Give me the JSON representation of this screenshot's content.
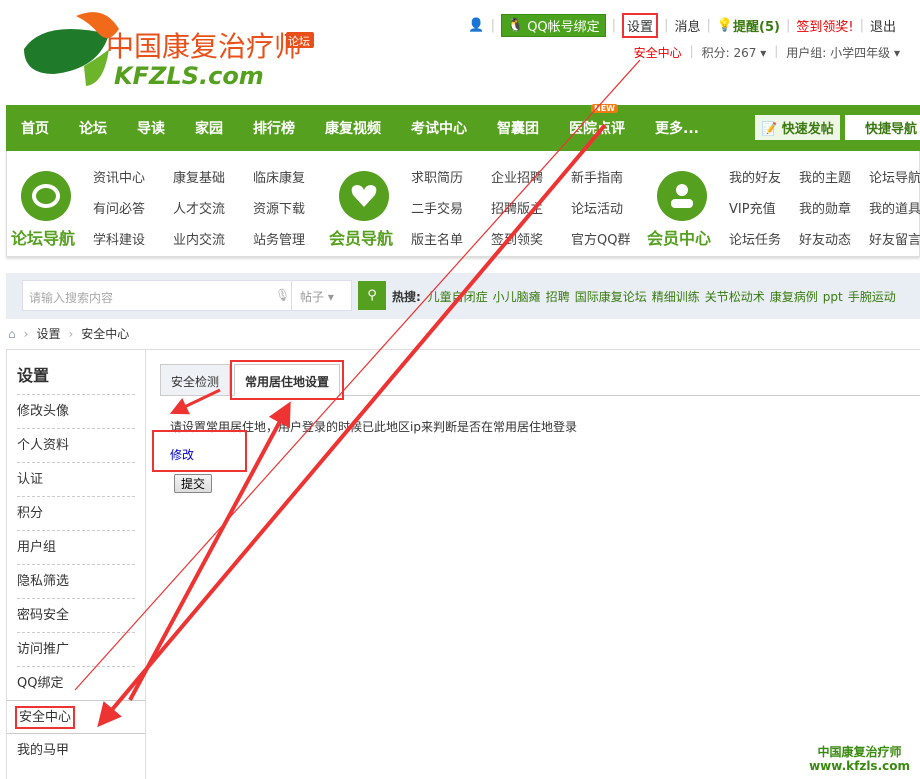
{
  "logo": {
    "text": "中国康复治疗师",
    "sub": "KFZLS.com",
    "badge": "论坛"
  },
  "top": {
    "qq_bind": "QQ帐号绑定",
    "settings": "设置",
    "messages": "消息",
    "remind": "提醒(5)",
    "checkin": "签到领奖!",
    "logout": "退出",
    "security": "安全中心",
    "points": "积分: 267",
    "group": "用户组: 小学四年级"
  },
  "nav": {
    "items": [
      "首页",
      "论坛",
      "导读",
      "家园",
      "排行榜",
      "康复视频",
      "考试中心",
      "智囊团",
      "医院点评",
      "更多..."
    ],
    "new_badge": "NEW",
    "fast_post": "快速发帖",
    "quick_nav": "快捷导航"
  },
  "groups": [
    {
      "title": "论坛导航",
      "icon": "chat-icon",
      "links": [
        "资讯中心",
        "康复基础",
        "临床康复",
        "有问必答",
        "人才交流",
        "资源下载",
        "学科建设",
        "业内交流",
        "站务管理"
      ]
    },
    {
      "title": "会员导航",
      "icon": "heart-icon",
      "links": [
        "求职简历",
        "企业招聘",
        "新手指南",
        "二手交易",
        "招聘版主",
        "论坛活动",
        "版主名单",
        "签到领奖",
        "官方QQ群"
      ]
    },
    {
      "title": "会员中心",
      "icon": "user-icon",
      "links": [
        "我的好友",
        "我的主题",
        "论坛导航",
        "VIP充值",
        "我的勋章",
        "我的道具",
        "论坛任务",
        "好友动态",
        "好友留言"
      ]
    }
  ],
  "search": {
    "placeholder": "请输入搜索内容",
    "type": "帖子",
    "hot_label": "热搜:",
    "hot": [
      "儿童自闭症",
      "小儿脑瘫",
      "招聘",
      "国际康复论坛",
      "精细训练",
      "关节松动术",
      "康复病例",
      "ppt",
      "手腕运动"
    ]
  },
  "breadcrumb": [
    "设置",
    "安全中心"
  ],
  "sidebar": {
    "title": "设置",
    "items": [
      "修改头像",
      "个人资料",
      "认证",
      "积分",
      "用户组",
      "隐私筛选",
      "密码安全",
      "访问推广",
      "QQ绑定",
      "安全中心",
      "我的马甲"
    ],
    "active": "安全中心"
  },
  "main": {
    "tabs": [
      "安全检测",
      "常用居住地设置"
    ],
    "active_tab": "常用居住地设置",
    "description": "请设置常用居住地，用户登录的时候已此地区ip来判断是否在常用居住地登录",
    "edit": "修改",
    "submit": "提交"
  },
  "watermark": {
    "line1": "中国康复治疗师",
    "line2": "www.kfzls.com"
  },
  "colors": {
    "brand_green": "#56a01f",
    "annotation_red": "#e33"
  }
}
